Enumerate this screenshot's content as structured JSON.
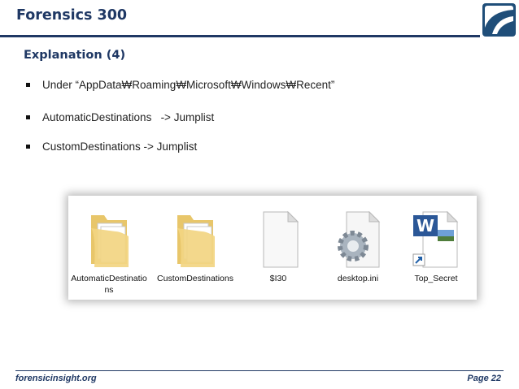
{
  "header": {
    "title": "Forensics 300"
  },
  "subtitle": "Explanation (4)",
  "bullets": [
    {
      "text": "Under “AppData₩Roaming₩Microsoft₩Windows₩Recent”"
    },
    {
      "text": "AutomaticDestinations   -> Jumplist"
    },
    {
      "text": "CustomDestinations -> Jumplist"
    }
  ],
  "files": [
    {
      "name": "AutomaticDestinations",
      "icon": "folder-icon"
    },
    {
      "name": "CustomDestinations",
      "icon": "folder-icon"
    },
    {
      "name": "$I30",
      "icon": "blank-file-icon"
    },
    {
      "name": "desktop.ini",
      "icon": "config-file-icon"
    },
    {
      "name": "Top_Secret",
      "icon": "word-shortcut-icon"
    }
  ],
  "footer": {
    "site": "forensicinsight.org",
    "page": "Page 22"
  },
  "colors": {
    "accent": "#1f3864",
    "logo": "#1f4e79",
    "folder": "#f2d582"
  }
}
